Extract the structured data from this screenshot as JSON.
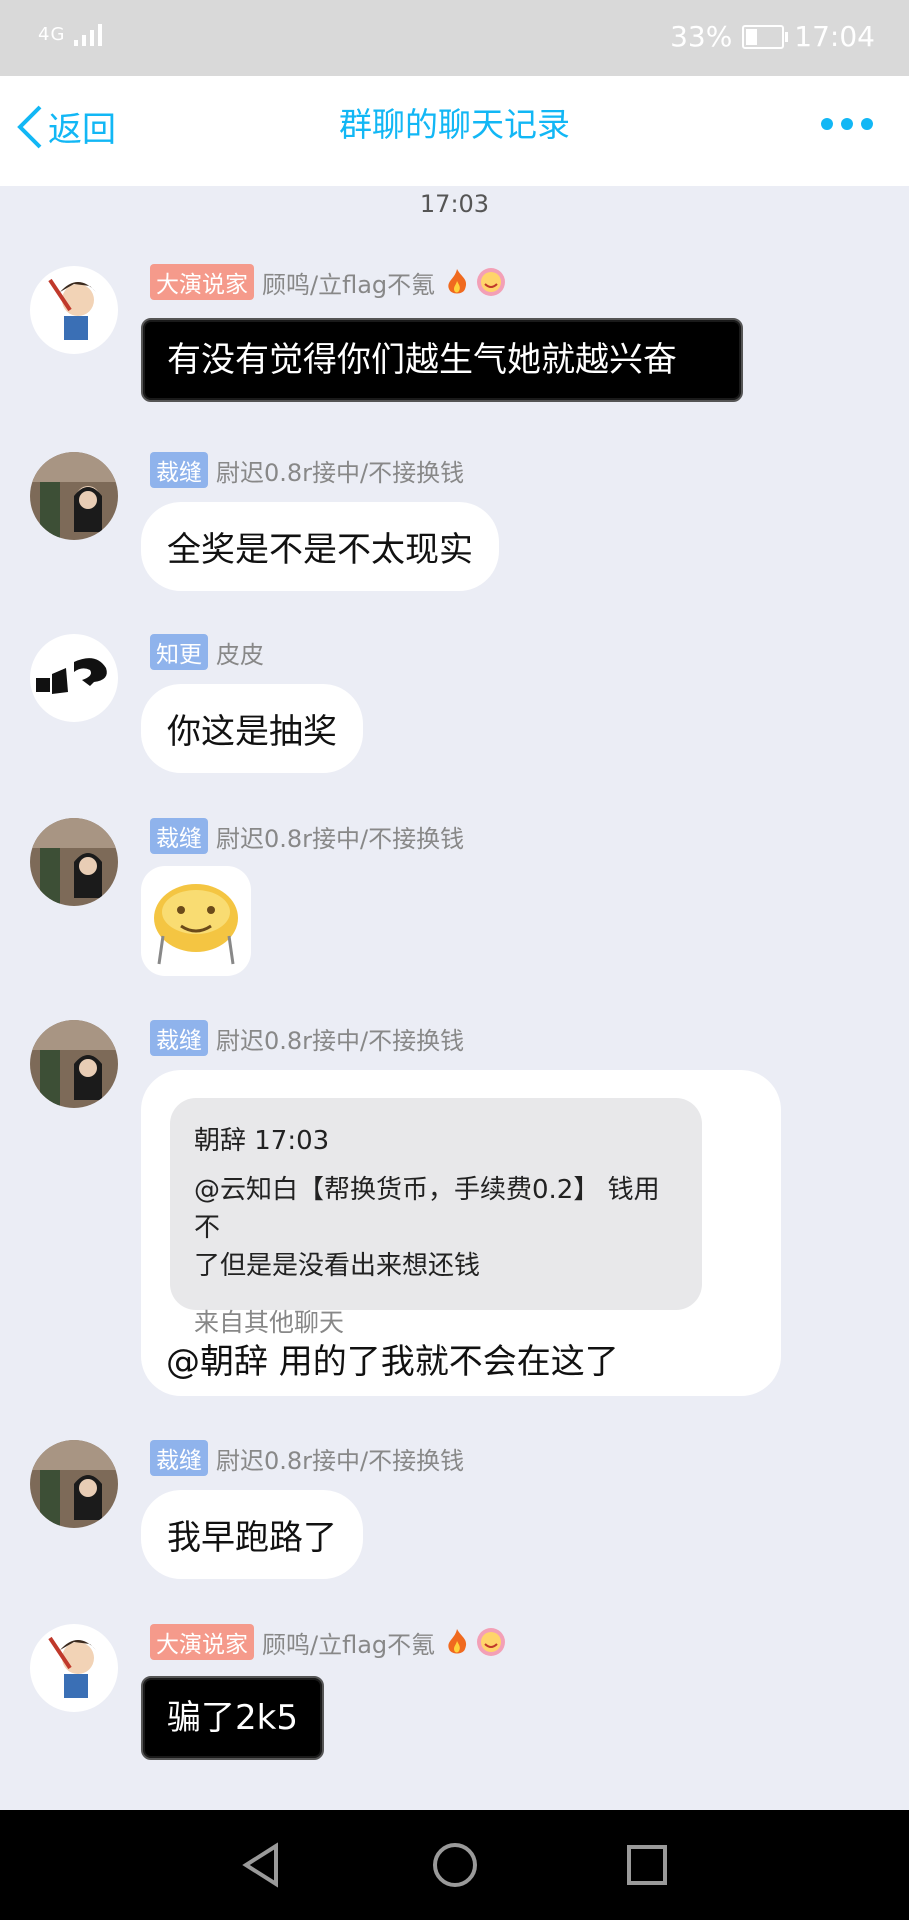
{
  "status_bar": {
    "network": "4G",
    "battery": "33%",
    "battery_level": 0.33,
    "time": "17:04"
  },
  "nav": {
    "back_label": "返回",
    "title": "群聊的聊天记录",
    "more_icon": "more-dots-icon"
  },
  "timestamp": "17:03",
  "messages": [
    {
      "tag": "大演说家",
      "name": "顾鸣/立flag不氪",
      "text": "有没有觉得你们越生气她就越兴奋"
    },
    {
      "tag": "裁缝",
      "name": "尉迟0.8r接中/不接换钱",
      "text": "全奖是不是不太现实"
    },
    {
      "tag": "知更",
      "name": "皮皮",
      "text": "你这是抽奖"
    },
    {
      "tag": "裁缝",
      "name": "尉迟0.8r接中/不接换钱",
      "sticker": "smiley-sticker"
    },
    {
      "tag": "裁缝",
      "name": "尉迟0.8r接中/不接换钱",
      "quote": {
        "header": "朝辞 17:03",
        "body_line1": "@云知白【帮换货币，手续费0.2】 钱用不",
        "body_line2": "了但是是没看出来想还钱",
        "source": "来自其他聊天"
      },
      "text": "@朝辞 用的了我就不会在这了"
    },
    {
      "tag": "裁缝",
      "name": "尉迟0.8r接中/不接换钱",
      "text": "我早跑路了"
    },
    {
      "tag": "大演说家",
      "name": "顾鸣/立flag不氪",
      "text": "骗了2k5"
    }
  ]
}
